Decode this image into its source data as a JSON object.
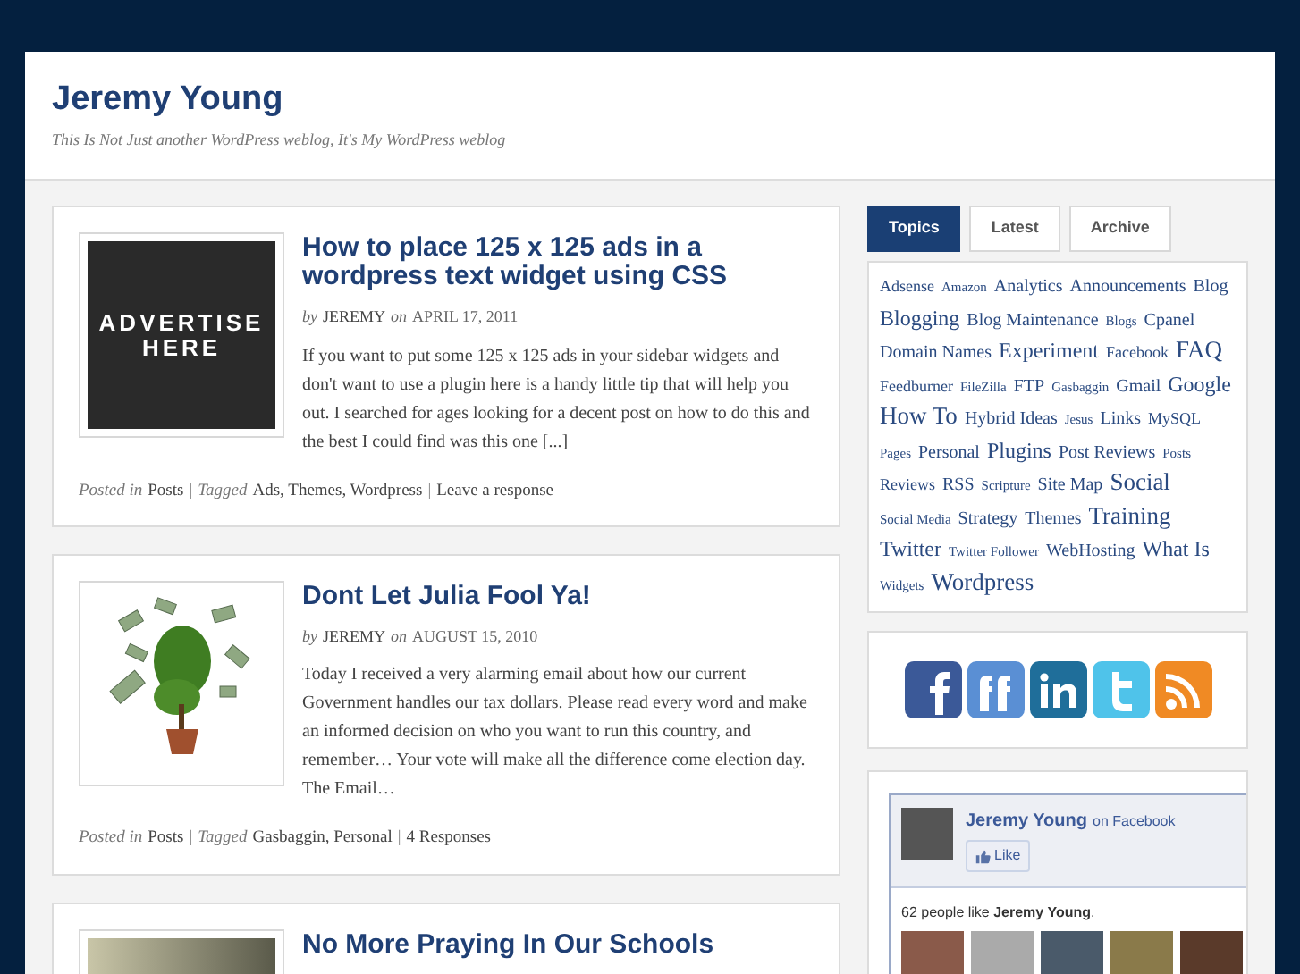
{
  "site": {
    "title": "Jeremy Young",
    "tagline": "This Is Not Just another WordPress weblog, It's My WordPress weblog"
  },
  "posts": [
    {
      "title": "How to place 125 x 125 ads in a wordpress text widget using CSS",
      "thumbnail": {
        "kind": "advert",
        "text": "ADVERTISE HERE"
      },
      "by": "by",
      "author": "JEREMY",
      "on": "on",
      "date": "APRIL 17, 2011",
      "excerpt": "If you want to put some 125 x 125 ads in your sidebar widgets and don't want to use a plugin here is a handy little tip that will help you out. I searched for ages looking for a decent post on how to do this and the best I could find was this one [...]",
      "posted_in": "Posted in",
      "category": "Posts",
      "separator_1": "|",
      "tagged": "Tagged",
      "tags": "Ads, Themes, Wordpress",
      "separator_2": "|",
      "comments": "Leave a response"
    },
    {
      "title": "Dont Let Julia Fool Ya!",
      "thumbnail": {
        "kind": "money-tree"
      },
      "by": "by",
      "author": "JEREMY",
      "on": "on",
      "date": "AUGUST 15, 2010",
      "excerpt": "Today I received a very alarming email about how our current Government handles our tax dollars. Please read every word and make an informed decision on who you want to run this country, and remember… Your vote will make all the difference come election day. The Email…",
      "posted_in": "Posted in",
      "category": "Posts",
      "separator_1": "|",
      "tagged": "Tagged",
      "tags": "Gasbaggin, Personal",
      "separator_2": "|",
      "comments": "4 Responses"
    },
    {
      "title": "No More Praying In Our Schools",
      "thumbnail": {
        "kind": "photo"
      }
    }
  ],
  "sidebar": {
    "tabs": [
      {
        "label": "Topics",
        "selected": true
      },
      {
        "label": "Latest",
        "selected": false
      },
      {
        "label": "Archive",
        "selected": false
      }
    ],
    "tag_cloud": [
      {
        "label": "Adsense",
        "kind": "s"
      },
      {
        "label": "Amazon",
        "kind": "xs"
      },
      {
        "label": "Analytics",
        "kind": "m"
      },
      {
        "label": "Announcements",
        "kind": "m"
      },
      {
        "label": "Blog",
        "kind": "m"
      },
      {
        "label": "Blogging",
        "kind": "l"
      },
      {
        "label": "Blog Maintenance",
        "kind": "m"
      },
      {
        "label": "Blogs",
        "kind": "xs"
      },
      {
        "label": "Cpanel",
        "kind": "m"
      },
      {
        "label": "Domain Names",
        "kind": "m"
      },
      {
        "label": "Experiment",
        "kind": "l"
      },
      {
        "label": "Facebook",
        "kind": "s"
      },
      {
        "label": "FAQ",
        "kind": "xl"
      },
      {
        "label": "Feedburner",
        "kind": "s"
      },
      {
        "label": "FileZilla",
        "kind": "xs"
      },
      {
        "label": "FTP",
        "kind": "m"
      },
      {
        "label": "Gasbaggin",
        "kind": "xs"
      },
      {
        "label": "Gmail",
        "kind": "m"
      },
      {
        "label": "Google",
        "kind": "l"
      },
      {
        "label": "How To",
        "kind": "xl"
      },
      {
        "label": "Hybrid Ideas",
        "kind": "m"
      },
      {
        "label": "Jesus",
        "kind": "xs"
      },
      {
        "label": "Links",
        "kind": "m"
      },
      {
        "label": "MySQL",
        "kind": "s"
      },
      {
        "label": "Pages",
        "kind": "xs"
      },
      {
        "label": "Personal",
        "kind": "m"
      },
      {
        "label": "Plugins",
        "kind": "l"
      },
      {
        "label": "Post Reviews",
        "kind": "m"
      },
      {
        "label": "Posts",
        "kind": "xs"
      },
      {
        "label": "Reviews",
        "kind": "s"
      },
      {
        "label": "RSS",
        "kind": "m"
      },
      {
        "label": "Scripture",
        "kind": "xs"
      },
      {
        "label": "Site Map",
        "kind": "m"
      },
      {
        "label": "Social",
        "kind": "xl"
      },
      {
        "label": "Social Media",
        "kind": "xs"
      },
      {
        "label": "Strategy",
        "kind": "m"
      },
      {
        "label": "Themes",
        "kind": "m"
      },
      {
        "label": "Training",
        "kind": "xl"
      },
      {
        "label": "Twitter",
        "kind": "l"
      },
      {
        "label": "Twitter Follower",
        "kind": "xs"
      },
      {
        "label": "WebHosting",
        "kind": "m"
      },
      {
        "label": "What Is",
        "kind": "l"
      },
      {
        "label": "Widgets",
        "kind": "xs"
      },
      {
        "label": "Wordpress",
        "kind": "xl"
      }
    ],
    "social_icons": [
      {
        "kind": "facebook"
      },
      {
        "kind": "friendfeed"
      },
      {
        "kind": "linkedin"
      },
      {
        "kind": "twitter"
      },
      {
        "kind": "rss"
      }
    ],
    "facebook_box": {
      "name": "Jeremy Young",
      "on": "on Facebook",
      "like": "Like",
      "fans_text": "62 people like **Jeremy Young**.",
      "fan_photos": [
        {
          "kind": "photo"
        },
        {
          "kind": "photo"
        },
        {
          "kind": "photo"
        },
        {
          "kind": "photo"
        },
        {
          "kind": "photo"
        }
      ]
    }
  }
}
